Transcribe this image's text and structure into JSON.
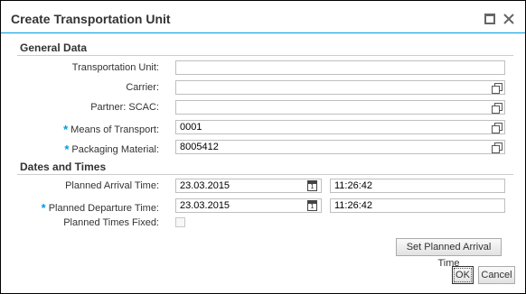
{
  "dialog": {
    "title": "Create Transportation Unit",
    "accent_color": "#009de0",
    "controls": [
      "maximize-icon",
      "close-icon"
    ]
  },
  "general_data": {
    "title": "General Data",
    "transportation_unit": {
      "label": "Transportation Unit:",
      "value": ""
    },
    "carrier": {
      "label": "Carrier:",
      "value": ""
    },
    "partner_scac": {
      "label": "Partner: SCAC:",
      "value": ""
    },
    "means_of_transport": {
      "label": "Means of Transport:",
      "value": "0001",
      "required": true
    },
    "packaging_material": {
      "label": "Packaging Material:",
      "value": "8005412",
      "required": true
    }
  },
  "dates_and_times": {
    "title": "Dates and Times",
    "planned_arrival": {
      "label": "Planned Arrival Time:",
      "date": "23.03.2015",
      "time": "11:26:42"
    },
    "planned_departure": {
      "label": "Planned Departure Time:",
      "date": "23.03.2015",
      "time": "11:26:42",
      "required": true
    },
    "planned_times_fixed": {
      "label": "Planned Times Fixed:",
      "checked": false
    },
    "calendar_day": "1"
  },
  "required_marker": "*",
  "buttons": {
    "set_planned_arrival": "Set Planned Arrival Time",
    "ok": "OK",
    "cancel": "Cancel"
  }
}
